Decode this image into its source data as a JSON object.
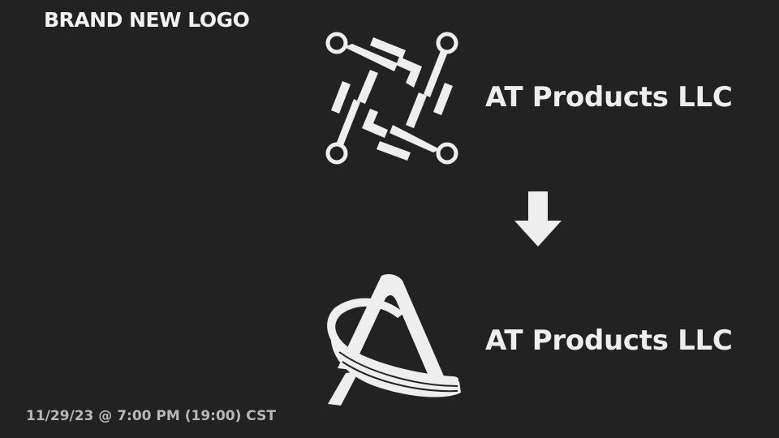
{
  "heading": "BRAND NEW LOGO",
  "old_logo": {
    "icon": "circuit-square-icon",
    "company_name": "AT Products LLC"
  },
  "new_logo": {
    "icon": "swoosh-letter-a-icon",
    "company_name": "AT Products LLC"
  },
  "transition_icon": "arrow-down-icon",
  "datetime": "11/29/23 @ 7:00 PM (19:00) CST",
  "colors": {
    "background": "#222222",
    "logo": "#eeeeee",
    "datetime_text": "#b8b8b8"
  }
}
